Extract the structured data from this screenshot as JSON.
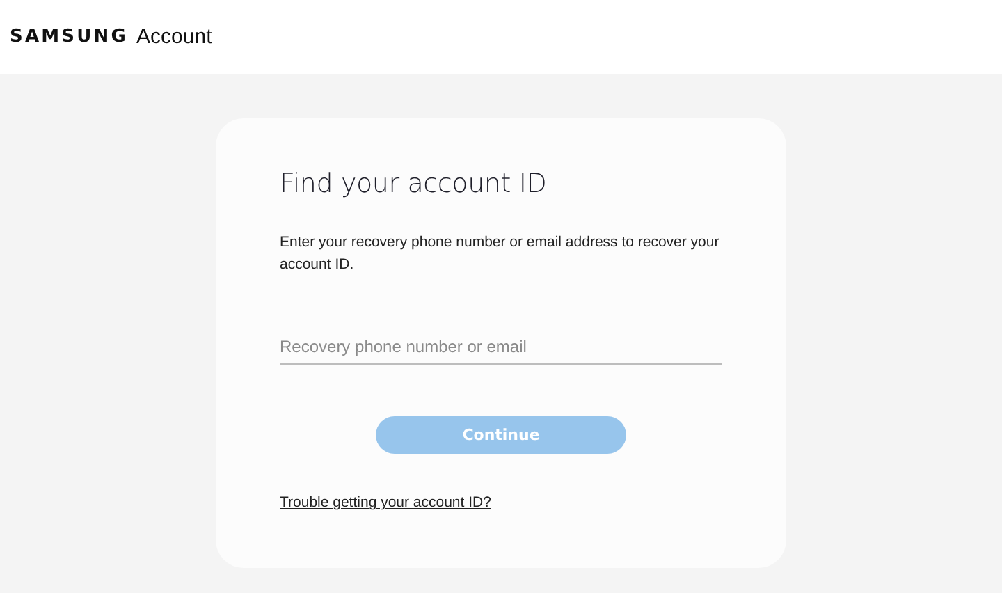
{
  "header": {
    "brand": "SAMSUNG",
    "product": "Account"
  },
  "card": {
    "title": "Find your account ID",
    "description": "Enter your recovery phone number or email address to recover your account ID.",
    "field": {
      "placeholder": "Recovery phone number or email"
    },
    "button": {
      "label": "Continue",
      "disabled": true
    },
    "link": "Trouble getting your account ID?"
  }
}
